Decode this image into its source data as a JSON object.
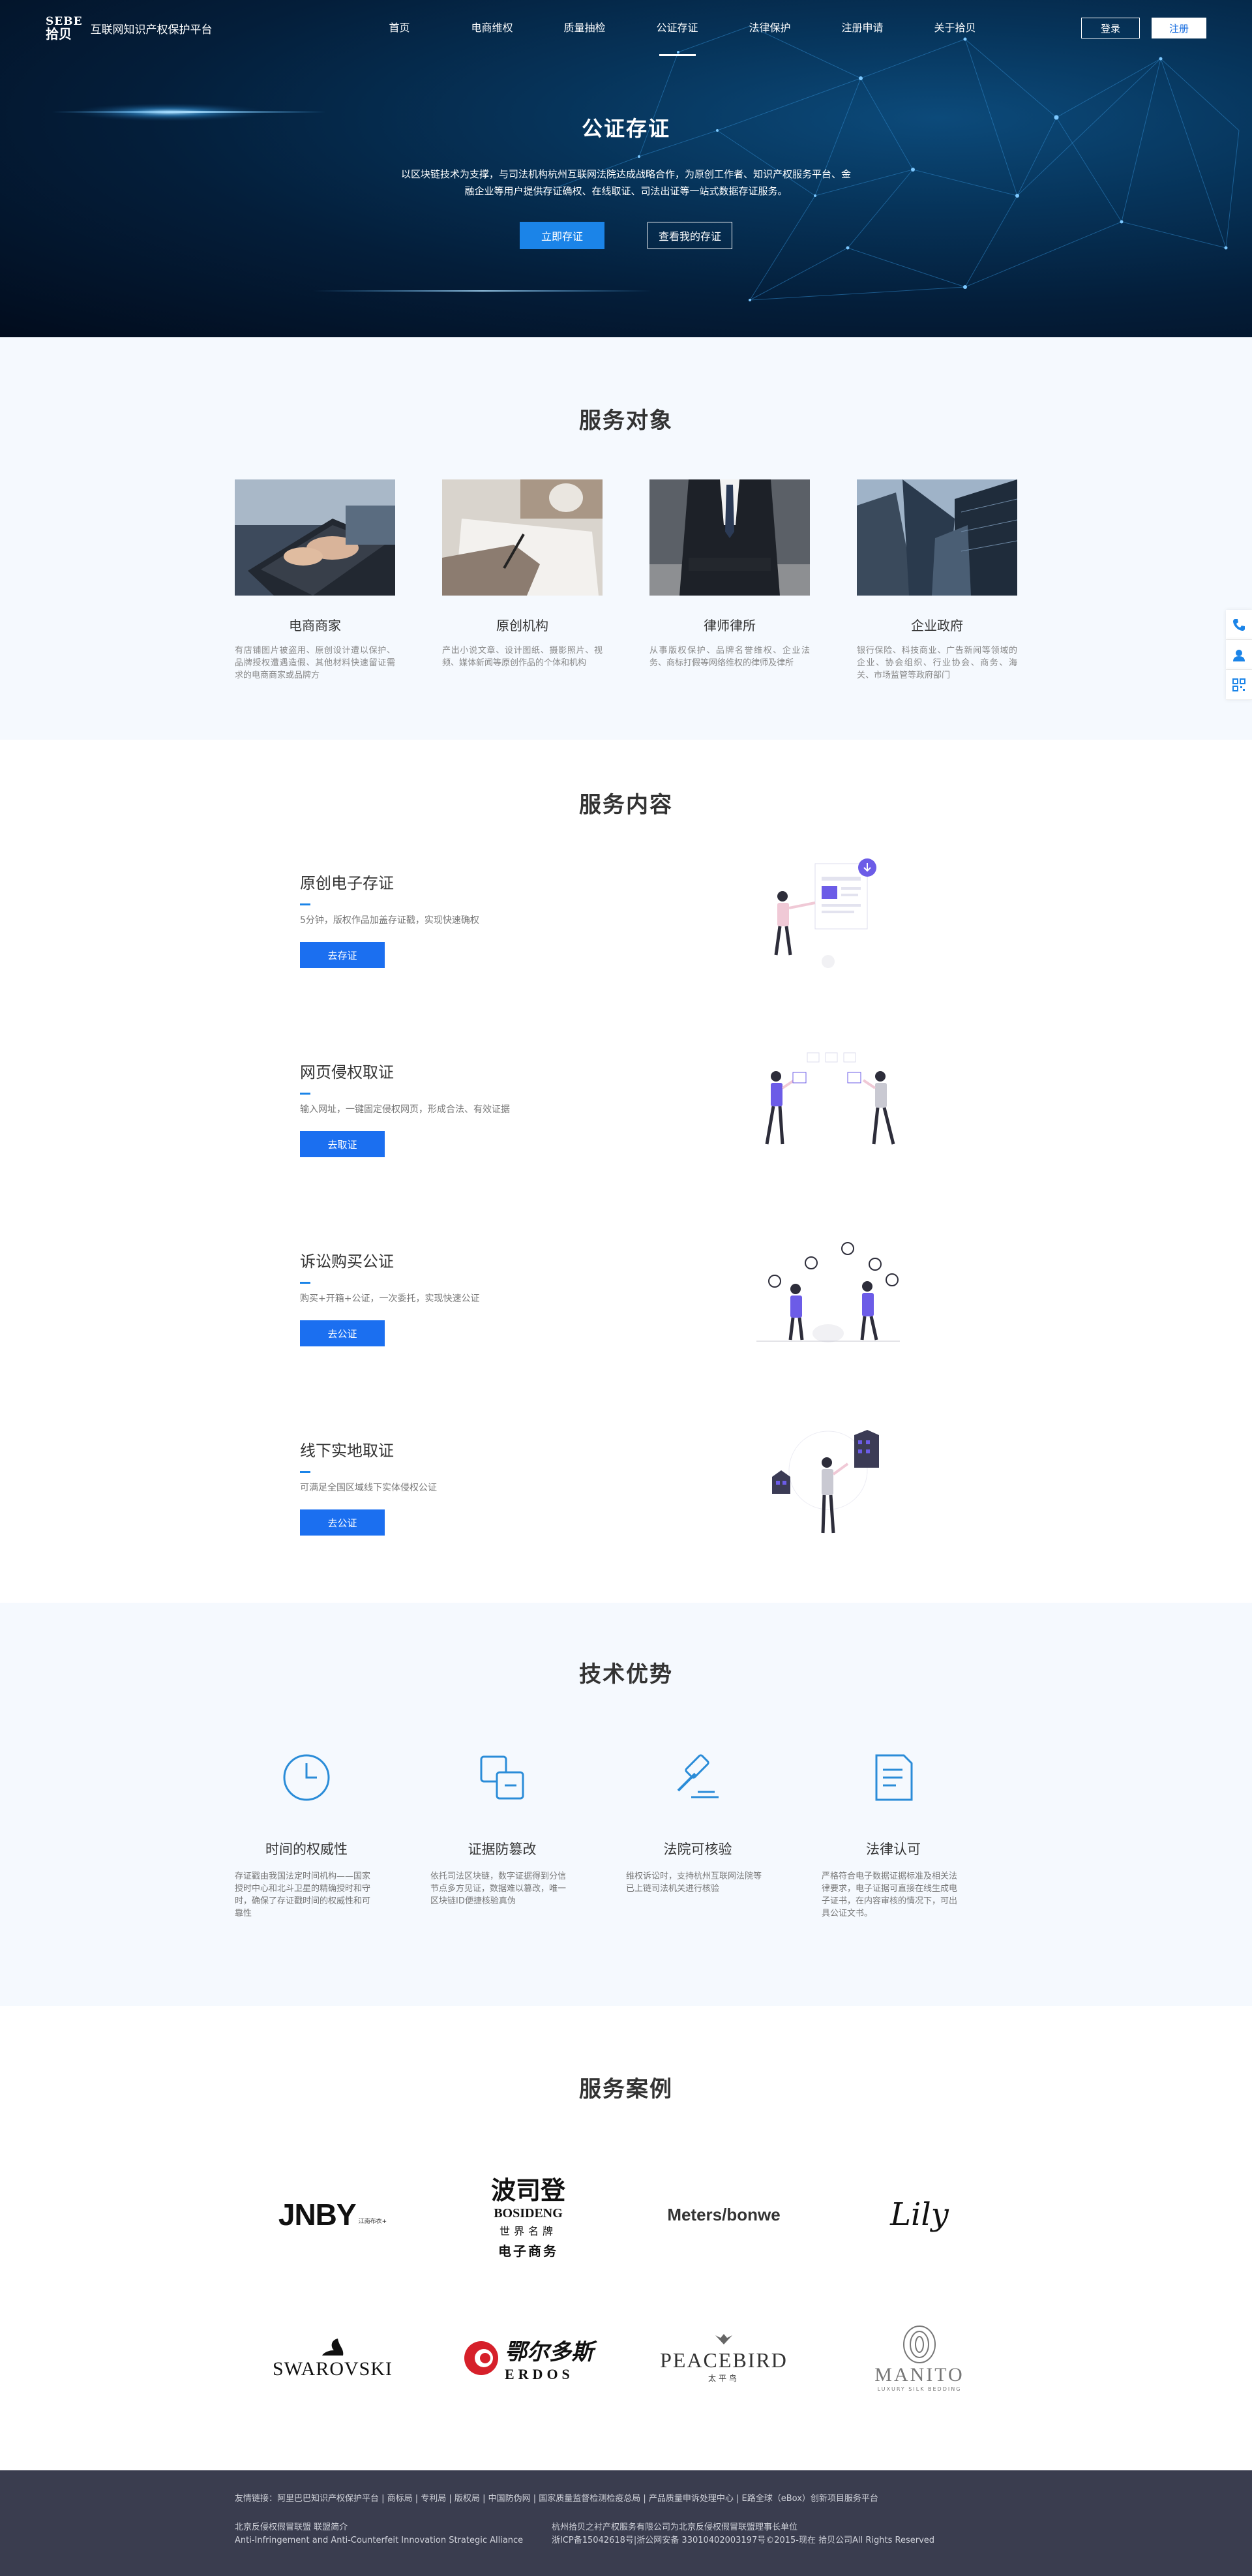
{
  "brand": {
    "logo_en": "SEBE",
    "logo_cn": "拾贝",
    "title": "互联网知识产权保护平台"
  },
  "nav": {
    "items": [
      "首页",
      "电商维权",
      "质量抽检",
      "公证存证",
      "法律保护",
      "注册申请",
      "关于拾贝"
    ],
    "active_index": 3
  },
  "auth": {
    "login": "登录",
    "register": "注册"
  },
  "hero": {
    "title": "公证存证",
    "desc": "以区块链技术为支撑，与司法机构杭州互联网法院达成战略合作，为原创工作者、知识产权服务平台、金融企业等用户提供存证确权、在线取证、司法出证等一站式数据存证服务。",
    "btn_primary": "立即存证",
    "btn_secondary": "查看我的存证"
  },
  "objects": {
    "title": "服务对象",
    "cards": [
      {
        "name": "电商商家",
        "desc": "有店铺图片被盗用、原创设计遭以保护、品牌授权遭遇造假、其他材料快速留证需求的电商商家或品牌方",
        "image": "laptop-typing-photo"
      },
      {
        "name": "原创机构",
        "desc": "产出小说文章、设计图纸、摄影照片、视频、媒体新闻等原创作品的个体和机构",
        "image": "hand-writing-photo"
      },
      {
        "name": "律师律所",
        "desc": "从事版权保护、品牌名誉维权、企业法务、商标打假等网络维权的律师及律所",
        "image": "businessman-suit-photo"
      },
      {
        "name": "企业政府",
        "desc": "银行保险、科技商业、广告新闻等领域的企业、协会组织、行业协会、商务、海关、市场监管等政府部门",
        "image": "skyscrapers-photo"
      }
    ]
  },
  "content": {
    "title": "服务内容",
    "services": [
      {
        "title": "原创电子存证",
        "desc": "5分钟，版权作品加盖存证戳，实现快速确权",
        "btn": "去存证"
      },
      {
        "title": "网页侵权取证",
        "desc": "输入网址，一键固定侵权网页，形成合法、有效证据",
        "btn": "去取证"
      },
      {
        "title": "诉讼购买公证",
        "desc": "购买+开箱+公证，一次委托，实现快速公证",
        "btn": "去公证"
      },
      {
        "title": "线下实地取证",
        "desc": "可满足全国区域线下实体侵权公证",
        "btn": "去公证"
      }
    ]
  },
  "tech": {
    "title": "技术优势",
    "items": [
      {
        "name": "时间的权威性",
        "desc": "存证戳由我国法定时间机构——国家授时中心和北斗卫星的精确授时和守时，确保了存证戳时间的权威性和可靠性",
        "icon": "clock-icon"
      },
      {
        "name": "证据防篡改",
        "desc": "依托司法区块链，数字证据得到分信节点多方见证，数据难以篡改，唯一区块链ID便捷核验真伪",
        "icon": "copy-blocks-icon"
      },
      {
        "name": "法院可核验",
        "desc": "维权诉讼时，支持杭州互联网法院等已上链司法机关进行核验",
        "icon": "gavel-icon"
      },
      {
        "name": "法律认可",
        "desc": "严格符合电子数据证据标准及相关法律要求，电子证据可直接在线生成电子证书，在内容审核的情况下，可出具公证文书。",
        "icon": "document-icon"
      }
    ]
  },
  "cases": {
    "title": "服务案例",
    "logos": [
      {
        "name": "JNBY",
        "sub": "江南布衣+"
      },
      {
        "name": "BOSIDENG",
        "sub": "世界名牌",
        "cn": "波司登",
        "extra": "电子商务"
      },
      {
        "name": "Meters/bonwe"
      },
      {
        "name": "Lily"
      },
      {
        "name": "SWAROVSKI"
      },
      {
        "name": "ERDOS",
        "cn": "鄂尔多斯"
      },
      {
        "name": "PEACEBIRD",
        "sub": "太平鸟"
      },
      {
        "name": "MANITO",
        "sub": "LUXURY SILK BEDDING"
      }
    ]
  },
  "footer": {
    "links": "友情链接：阿里巴巴知识产权保护平台 | 商标局 | 专利局 | 版权局 | 中国防伪网 | 国家质量监督检测检疫总局 | 产品质量申诉处理中心 | E路全球（eBox）创新项目服务平台",
    "left_line1": "北京反侵权假冒联盟 联盟简介",
    "left_line2": "Anti-Infringement and Anti-Counterfeit Innovation Strategic Alliance",
    "right_line1": "杭州拾贝之衬产权服务有限公司为北京反侵权假冒联盟理事长单位",
    "right_line2": "浙ICP备15042618号|浙公网安备 33010402003197号©2015-现在 拾贝公司All Rights Reserved"
  },
  "colors": {
    "primary": "#1b6ff0",
    "accent_bar": "#1b84e8",
    "section_bg": "#f5f9fe",
    "footer_bg": "#3a3d4f",
    "icon_blue": "#2a8cd8",
    "illus_purple": "#6c5ce7"
  }
}
